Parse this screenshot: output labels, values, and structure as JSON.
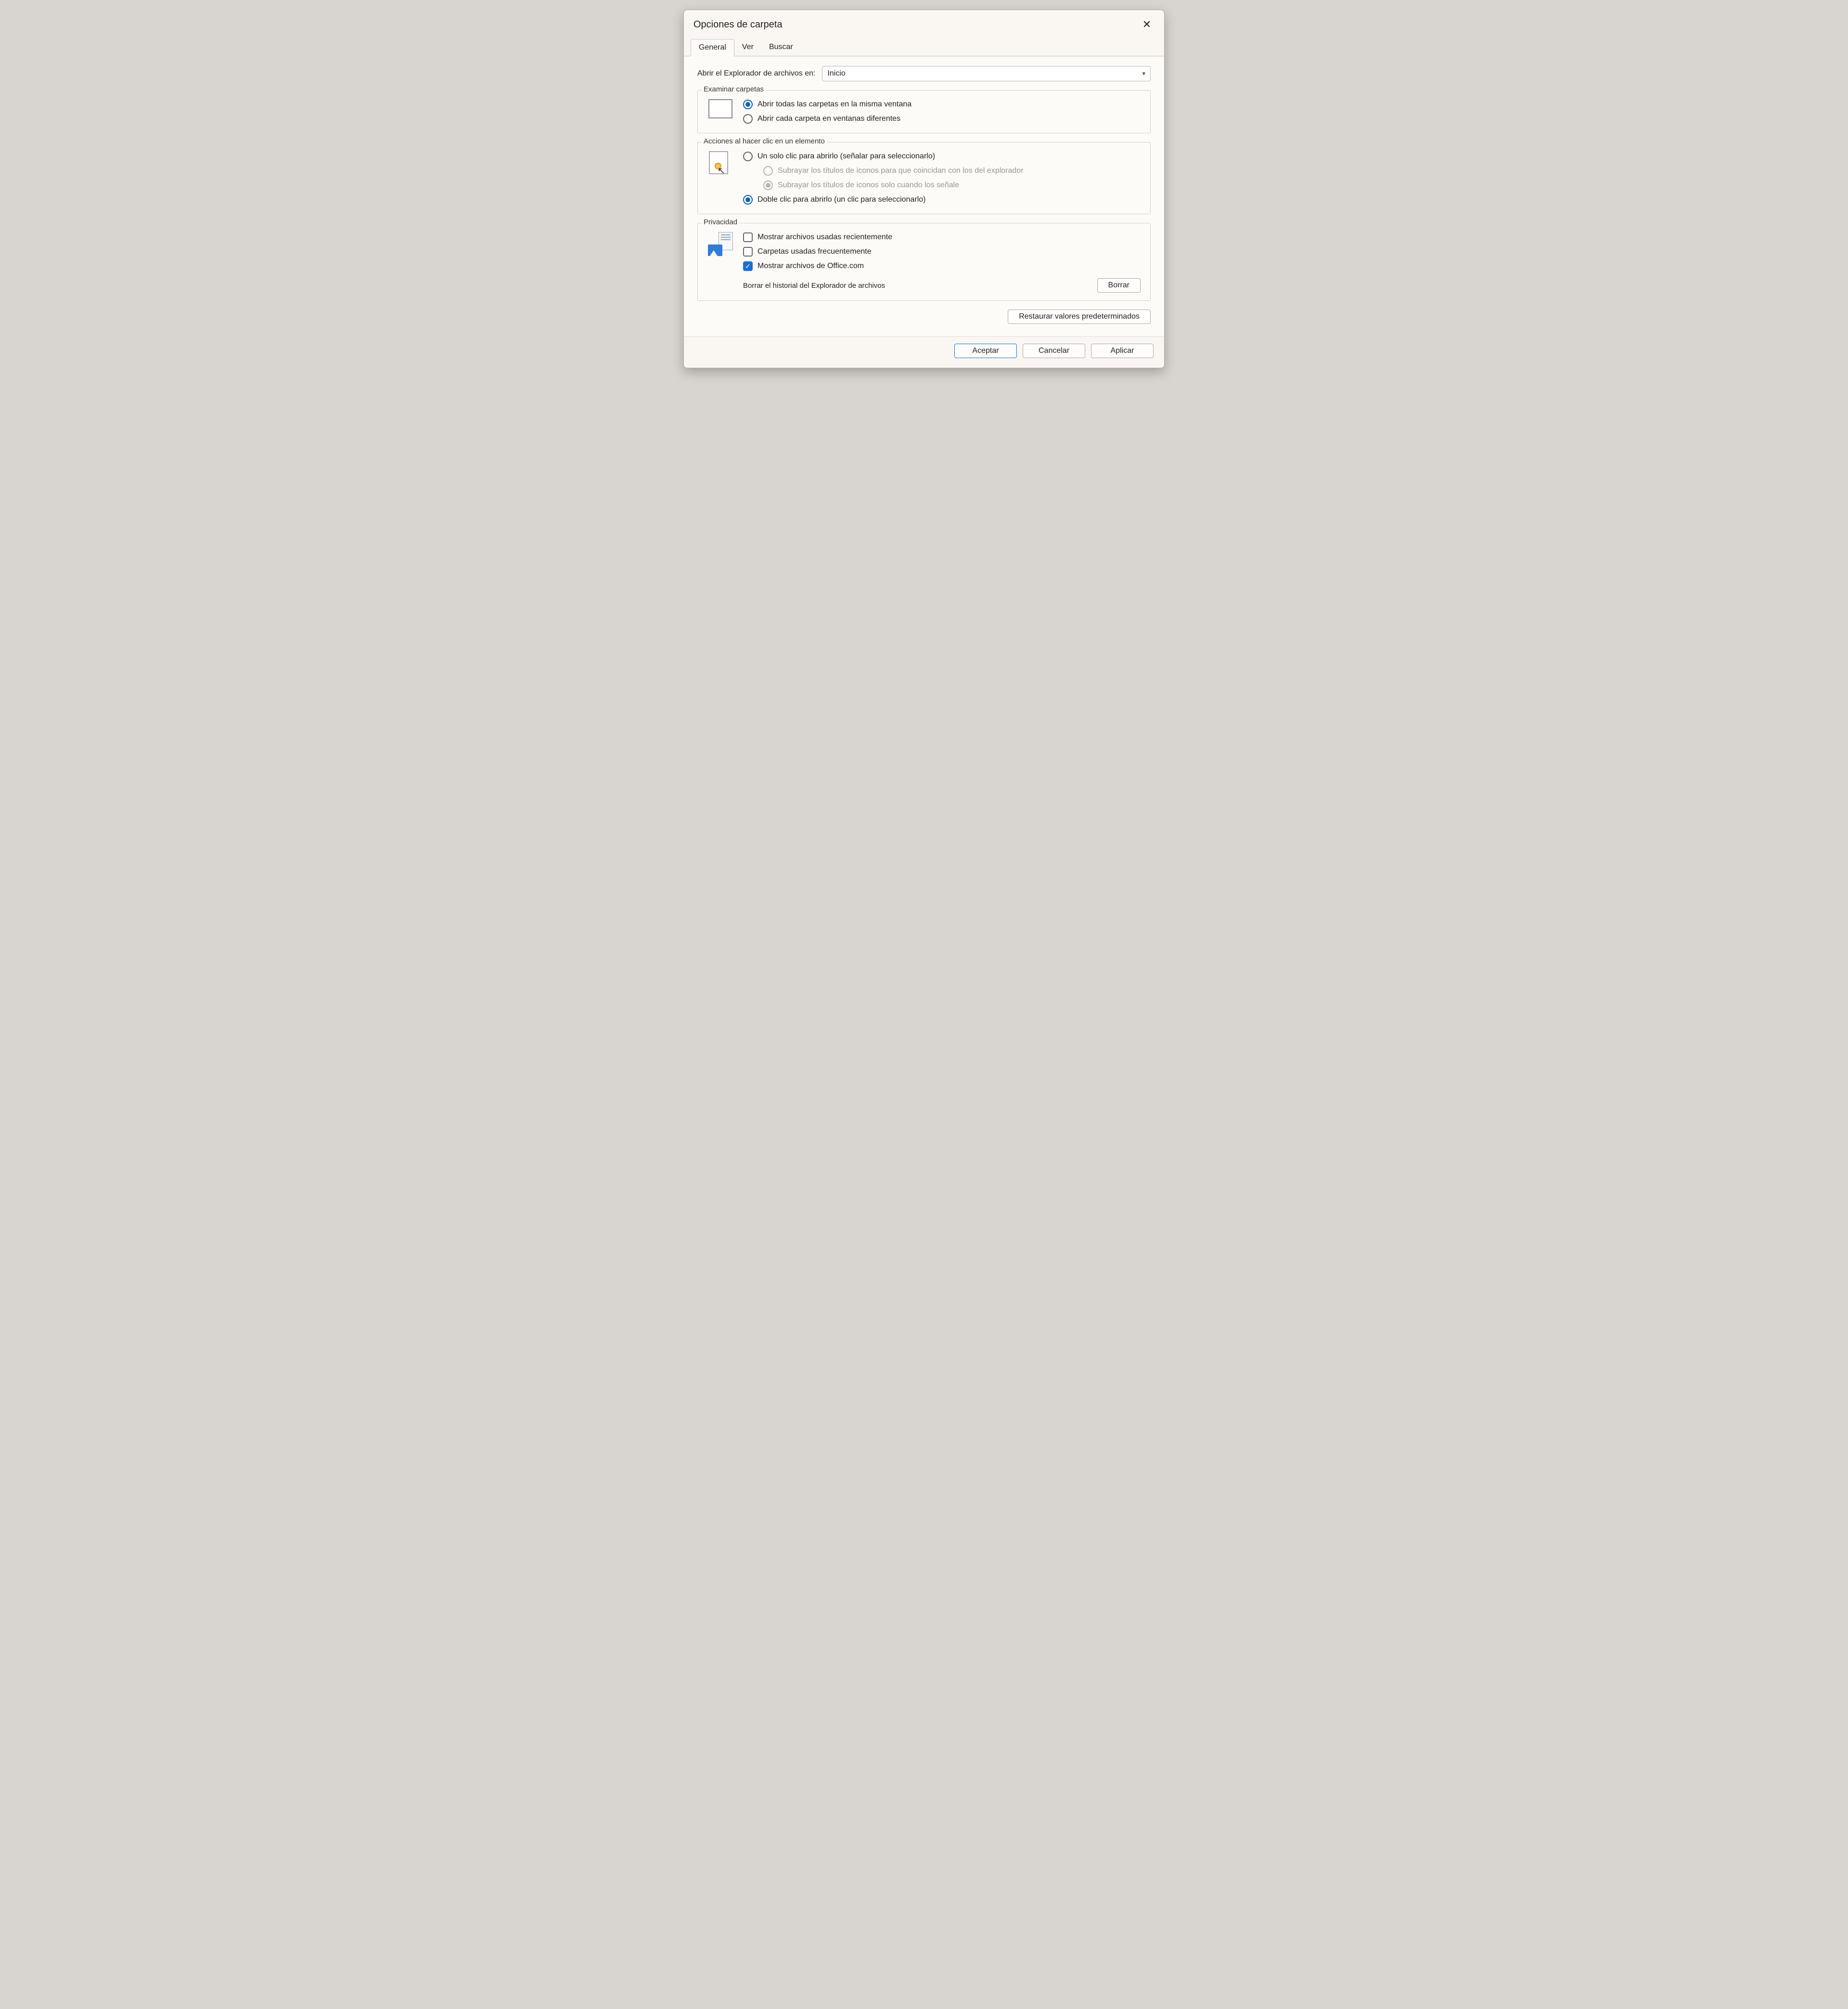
{
  "dialog": {
    "title": "Opciones de carpeta",
    "close_glyph": "✕"
  },
  "tabs": [
    "General",
    "Ver",
    "Buscar"
  ],
  "open_explorer": {
    "label": "Abrir el Explorador de archivos en:",
    "selected": "Inicio"
  },
  "group_browse": {
    "title": "Examinar carpetas",
    "opt_same": "Abrir todas las carpetas en la misma ventana",
    "opt_diff": "Abrir cada carpeta en ventanas diferentes"
  },
  "group_click": {
    "title": "Acciones al hacer clic en un elemento",
    "opt_single": "Un solo clic para abrirlo (señalar para seleccionarlo)",
    "sub_underline_browser": "Subrayar los títulos de iconos para que coincidan con los del explorador",
    "sub_underline_hover": "Subrayar los títulos de iconos solo cuando los señale",
    "opt_double": "Doble clic para abrirlo (un clic para seleccionarlo)"
  },
  "group_privacy": {
    "title": "Privacidad",
    "chk_recent": "Mostrar archivos usadas recientemente",
    "chk_frequent": "Carpetas usadas frecuentemente",
    "chk_office": "Mostrar archivos de Office.com",
    "clear_label": "Borrar el historial del Explorador de archivos",
    "clear_btn": "Borrar"
  },
  "restore_defaults": "Restaurar valores predeterminados",
  "footer": {
    "ok": "Aceptar",
    "cancel": "Cancelar",
    "apply": "Aplicar"
  }
}
